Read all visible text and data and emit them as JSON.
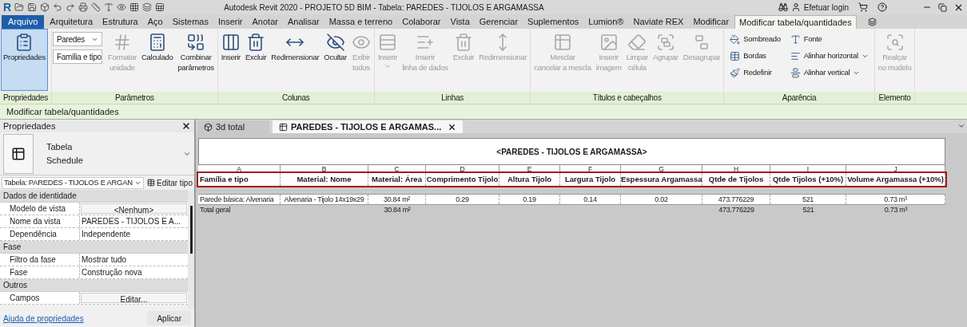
{
  "title_bar": {
    "app_logo": "R",
    "title": "Autodesk Revit 2020 - PROJETO 5D BIM - Tabela: PAREDES - TIJOLOS E ARGAMASSA",
    "login": "Efetuar login"
  },
  "file_tab": "Arquivo",
  "menu_tabs": [
    {
      "label": "Arquitetura",
      "selected": false
    },
    {
      "label": "Estrutura",
      "selected": false
    },
    {
      "label": "Aço",
      "selected": false
    },
    {
      "label": "Sistemas",
      "selected": false
    },
    {
      "label": "Inserir",
      "selected": false
    },
    {
      "label": "Anotar",
      "selected": false
    },
    {
      "label": "Analisar",
      "selected": false
    },
    {
      "label": "Massa e terreno",
      "selected": false
    },
    {
      "label": "Colaborar",
      "selected": false
    },
    {
      "label": "Vista",
      "selected": false
    },
    {
      "label": "Gerenciar",
      "selected": false
    },
    {
      "label": "Suplementos",
      "selected": false
    },
    {
      "label": "Lumion®",
      "selected": false
    },
    {
      "label": "Naviate REX",
      "selected": false
    },
    {
      "label": "Modificar",
      "selected": false
    },
    {
      "label": "Modificar tabela/quantidades",
      "selected": true
    }
  ],
  "ribbon": [
    {
      "label": "Propriedades",
      "items": [
        {
          "kind": "large",
          "lines": [
            "Propriedades"
          ],
          "on": true,
          "disabled": false
        }
      ]
    },
    {
      "label": "Parâmetros",
      "items": [
        {
          "kind": "dropdown",
          "value": "Paredes"
        },
        {
          "kind": "dropdown",
          "value": "Família e tipo"
        },
        {
          "kind": "large",
          "lines": [
            "Formatar",
            "unidade"
          ],
          "on": false,
          "disabled": true
        },
        {
          "kind": "large",
          "lines": [
            "Calculado"
          ],
          "on": false,
          "disabled": false
        },
        {
          "kind": "large",
          "lines": [
            "Combinar",
            "parâmetros"
          ],
          "on": false,
          "disabled": false
        }
      ]
    },
    {
      "label": "Colunas",
      "items": [
        {
          "kind": "large",
          "lines": [
            "Inserir"
          ],
          "on": false,
          "disabled": false
        },
        {
          "kind": "large",
          "lines": [
            "Excluir"
          ],
          "on": false,
          "disabled": false
        },
        {
          "kind": "large",
          "lines": [
            "Redimensionar"
          ],
          "on": false,
          "disabled": false
        },
        {
          "kind": "large",
          "lines": [
            "Ocultar"
          ],
          "on": false,
          "disabled": false
        },
        {
          "kind": "large",
          "lines": [
            "Exibir",
            "todos"
          ],
          "on": false,
          "disabled": true
        }
      ]
    },
    {
      "label": "Linhas",
      "items": [
        {
          "kind": "large",
          "lines": [
            "Inserir"
          ],
          "on": false,
          "disabled": true,
          "caret": true
        },
        {
          "kind": "large",
          "lines": [
            "Inserir",
            "linha de dados"
          ],
          "on": false,
          "disabled": true
        },
        {
          "kind": "large",
          "lines": [
            "Excluir"
          ],
          "on": false,
          "disabled": true
        },
        {
          "kind": "large",
          "lines": [
            "Redimensionar"
          ],
          "on": false,
          "disabled": true
        }
      ]
    },
    {
      "label": "Títulos e cabeçalhos",
      "items": [
        {
          "kind": "large",
          "lines": [
            "Mesclar",
            "cancelar a mescla"
          ],
          "on": false,
          "disabled": true
        },
        {
          "kind": "large",
          "lines": [
            "Inserir",
            "imagem"
          ],
          "on": false,
          "disabled": true
        },
        {
          "kind": "large",
          "lines": [
            "Limpar",
            "célula"
          ],
          "on": false,
          "disabled": true
        },
        {
          "kind": "large",
          "lines": [
            "Agrupar"
          ],
          "on": false,
          "disabled": true
        },
        {
          "kind": "large",
          "lines": [
            "Desagrupar"
          ],
          "on": false,
          "disabled": true
        }
      ]
    },
    {
      "label": "Aparência",
      "items": [
        {
          "kind": "small",
          "lines": [
            "Sombreado"
          ],
          "on": false,
          "disabled": false
        },
        {
          "kind": "small",
          "lines": [
            "Bordas"
          ],
          "on": false,
          "disabled": false
        },
        {
          "kind": "small",
          "lines": [
            "Redefinir"
          ],
          "on": false,
          "disabled": false
        },
        {
          "kind": "small",
          "lines": [
            "Fonte"
          ],
          "on": false,
          "disabled": false
        },
        {
          "kind": "small",
          "lines": [
            "Alinhar horizontal"
          ],
          "on": false,
          "disabled": false,
          "caret": true
        },
        {
          "kind": "small",
          "lines": [
            "Alinhar vertical"
          ],
          "on": false,
          "disabled": false,
          "caret": true
        }
      ]
    },
    {
      "label": "Elemento",
      "items": [
        {
          "kind": "large",
          "lines": [
            "Realçar",
            "no modelo"
          ],
          "on": false,
          "disabled": true
        }
      ]
    }
  ],
  "context_bar": "Modificar tabela/quantidades",
  "properties": {
    "title": "Propriedades",
    "type_name": "Tabela",
    "type_sub": "Schedule",
    "selector": "Tabela: PAREDES - TIJOLOS E ARGAN",
    "edit_type": "Editar tipo",
    "sections": [
      {
        "name": "Dados de identidade",
        "rows": [
          {
            "label": "Modelo de vista",
            "value": "<Nenhum>",
            "kind": "button"
          },
          {
            "label": "Nome da vista",
            "value": "PAREDES - TIJOLOS E A...",
            "kind": "text"
          },
          {
            "label": "Dependência",
            "value": "Independente",
            "kind": "text"
          }
        ]
      },
      {
        "name": "Fase",
        "rows": [
          {
            "label": "Filtro da fase",
            "value": "Mostrar tudo",
            "kind": "text"
          },
          {
            "label": "Fase",
            "value": "Construção nova",
            "kind": "text"
          }
        ]
      },
      {
        "name": "Outros",
        "rows": [
          {
            "label": "Campos",
            "value": "Editar...",
            "kind": "button"
          }
        ]
      }
    ],
    "help_link": "Ajuda de propriedades",
    "apply": "Aplicar"
  },
  "view_tabs": [
    {
      "label": "3d total",
      "selected": false,
      "kind": "model"
    },
    {
      "label": "PAREDES - TIJOLOS E ARGAMAS...",
      "selected": true,
      "kind": "schedule"
    }
  ],
  "schedule": {
    "title": "<PAREDES - TIJOLOS E ARGAMASSA>",
    "header_highlighted": true,
    "columns": [
      {
        "letter": "A",
        "header": "Família e tipo"
      },
      {
        "letter": "B",
        "header": "Material: Nome"
      },
      {
        "letter": "C",
        "header": "Material: Área"
      },
      {
        "letter": "D",
        "header": "Comprimento Tijolo"
      },
      {
        "letter": "E",
        "header": "Altura Tijolo"
      },
      {
        "letter": "F",
        "header": "Largura Tijolo"
      },
      {
        "letter": "G",
        "header": "Espessura Argamassa"
      },
      {
        "letter": "H",
        "header": "Qtde de Tijolos"
      },
      {
        "letter": "I",
        "header": "Qtde Tijolos (+10%)"
      },
      {
        "letter": "J",
        "header": "Volume Argamassa (+10%)"
      }
    ],
    "rows": [
      {
        "kind": "data",
        "cells": {
          "column_1": "Parede básica: Alvenaria",
          "column_2": "Alvenaria - Tijolo 14x19x29",
          "column_3": "30.84 m²",
          "column_4": "0.29",
          "column_5": "0.19",
          "column_6": "0.14",
          "column_7": "0.02",
          "column_8": "473.776229",
          "column_9": "521",
          "column_10": "0.73 m³"
        }
      },
      {
        "kind": "total",
        "cells": {
          "column_1": "Total geral",
          "column_3": "30.84 m²",
          "column_8": "473.776229",
          "column_9": "521",
          "column_10": "0.73 m³"
        }
      }
    ]
  }
}
